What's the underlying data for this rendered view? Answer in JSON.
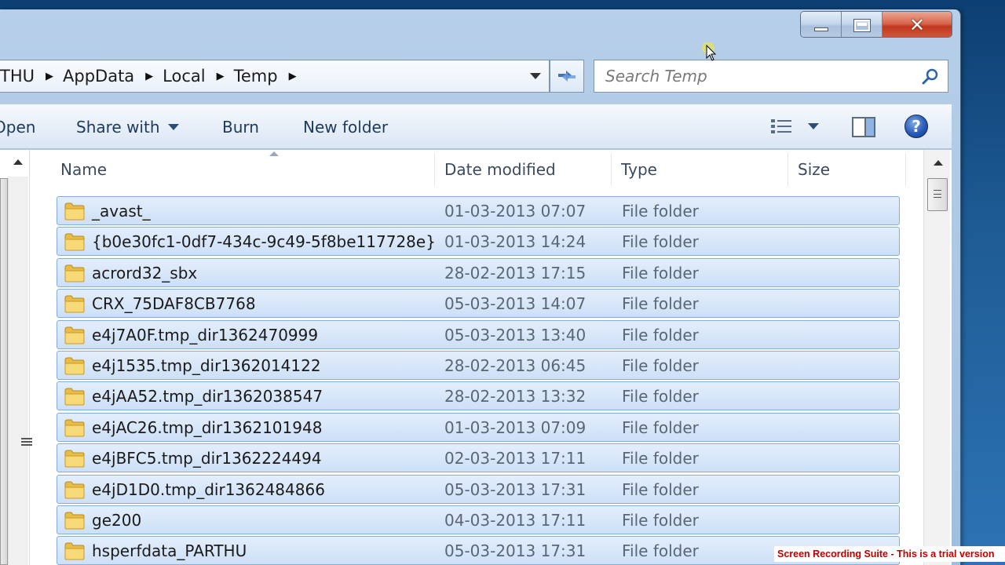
{
  "window": {
    "caption_buttons": {
      "minimize_icon": "minimize-icon",
      "maximize_icon": "maximize-icon",
      "close_glyph": "✕"
    }
  },
  "address_bar": {
    "crumbs": [
      "THU",
      "AppData",
      "Local",
      "Temp"
    ],
    "refresh_icon": "refresh-icon"
  },
  "search": {
    "placeholder": "Search Temp",
    "icon": "search-icon"
  },
  "toolbar": {
    "open_label": "Open",
    "share_label": "Share with",
    "burn_label": "Burn",
    "new_folder_label": "New folder",
    "help_label": "?"
  },
  "columns": {
    "name": "Name",
    "date": "Date modified",
    "type": "Type",
    "size": "Size"
  },
  "files": [
    {
      "name": "_avast_",
      "date": "01-03-2013 07:07",
      "type": "File folder"
    },
    {
      "name": "{b0e30fc1-0df7-434c-9c49-5f8be117728e}",
      "date": "01-03-2013 14:24",
      "type": "File folder"
    },
    {
      "name": "acrord32_sbx",
      "date": "28-02-2013 17:15",
      "type": "File folder"
    },
    {
      "name": "CRX_75DAF8CB7768",
      "date": "05-03-2013 14:07",
      "type": "File folder"
    },
    {
      "name": "e4j7A0F.tmp_dir1362470999",
      "date": "05-03-2013 13:40",
      "type": "File folder"
    },
    {
      "name": "e4j1535.tmp_dir1362014122",
      "date": "28-02-2013 06:45",
      "type": "File folder"
    },
    {
      "name": "e4jAA52.tmp_dir1362038547",
      "date": "28-02-2013 13:32",
      "type": "File folder"
    },
    {
      "name": "e4jAC26.tmp_dir1362101948",
      "date": "01-03-2013 07:09",
      "type": "File folder"
    },
    {
      "name": "e4jBFC5.tmp_dir1362224494",
      "date": "02-03-2013 17:11",
      "type": "File folder"
    },
    {
      "name": "e4jD1D0.tmp_dir1362484866",
      "date": "05-03-2013 17:31",
      "type": "File folder"
    },
    {
      "name": "ge200",
      "date": "04-03-2013 17:11",
      "type": "File folder"
    },
    {
      "name": "hsperfdata_PARTHU",
      "date": "05-03-2013 17:31",
      "type": "File folder"
    }
  ],
  "watermark": "Screen Recording Suite - This is a trial version"
}
